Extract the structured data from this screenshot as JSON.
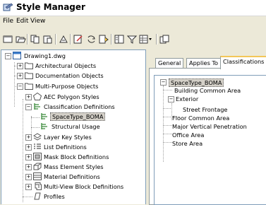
{
  "window": {
    "title": "Style Manager"
  },
  "menu": [
    "File",
    "Edit",
    "View"
  ],
  "toolbar": [
    "new-icon",
    "open-icon",
    "copy-icon",
    "paste-icon",
    "purge-icon",
    "edit-style-icon",
    "refresh-icon",
    "import-export-icon",
    "toggle-view-icon",
    "filter-icon",
    "view-options-icon",
    "inline-edit-icon"
  ],
  "tree": {
    "root": "Drawing1.dwg",
    "architectural": "Architectural Objects",
    "documentation": "Documentation Objects",
    "multipurpose": "Multi-Purpose Objects",
    "children": [
      "AEC Polygon Styles",
      "Classification Definitions",
      "SpaceType_BOMA",
      "Structural Usage",
      "Layer Key Styles",
      "List Definitions",
      "Mask Block Definitions",
      "Mass Element Styles",
      "Material Definitions",
      "Multi-View Block Definitions",
      "Profiles"
    ]
  },
  "tabs": [
    "General",
    "Applies To",
    "Classifications"
  ],
  "classifications": {
    "root": "SpaceType_BOMA",
    "items": [
      "Building Common Area",
      "Exterior",
      "Street Frontage",
      "Floor Common Area",
      "Major Vertical Penetration",
      "Office Area",
      "Store Area"
    ]
  }
}
